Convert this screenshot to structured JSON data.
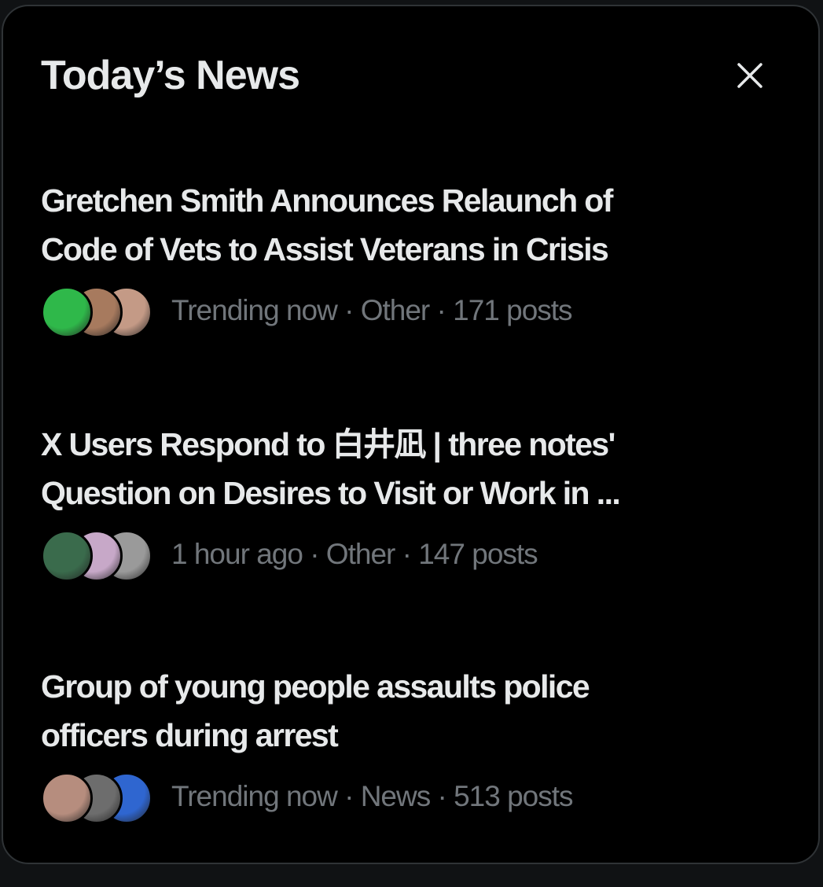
{
  "panel": {
    "title": "Today’s News",
    "close_icon": "close-icon"
  },
  "news": [
    {
      "headline_line1": "Gretchen Smith Announces Relaunch of",
      "headline_line2": "Code of Vets to Assist Veterans in Crisis",
      "meta": "Trending now · Other · 171 posts",
      "avatar_colors": [
        "#2fb84a",
        "#a77a5e",
        "#c49a86"
      ]
    },
    {
      "headline_line1": "X Users Respond to 白井凪 | three notes'",
      "headline_line2": "Question on Desires to Visit or Work in ...",
      "meta": "1 hour ago · Other · 147 posts",
      "avatar_colors": [
        "#3a6b4c",
        "#c7a8c8",
        "#9a9a9a"
      ]
    },
    {
      "headline_line1": "Group of young people assaults police",
      "headline_line2": "officers during arrest",
      "meta": "Trending now · News · 513 posts",
      "avatar_colors": [
        "#b68d7e",
        "#6d6d6d",
        "#2f66d0"
      ]
    }
  ],
  "colors": {
    "background": "#000000",
    "primary_text": "#e7e9ea",
    "secondary_text": "#71767b",
    "border": "#2f3336"
  }
}
